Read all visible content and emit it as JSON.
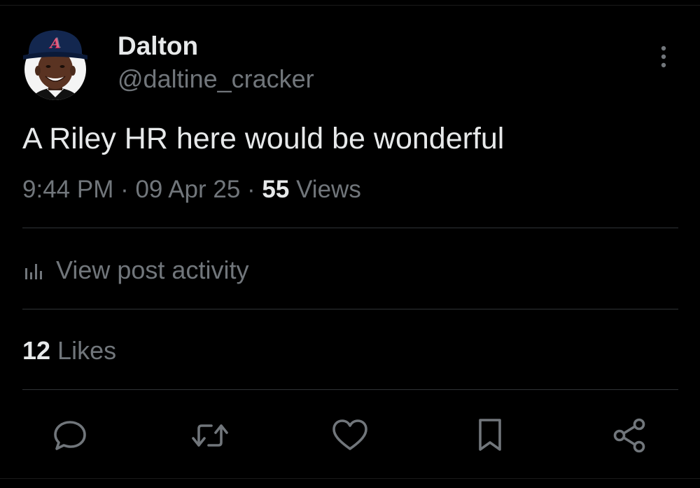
{
  "user": {
    "display_name": "Dalton",
    "handle": "@daltine_cracker",
    "avatar_icon": "avatar-photo"
  },
  "post": {
    "text": "A Riley HR here would be wonderful",
    "time": "9:44 PM",
    "date": "09 Apr 25",
    "separator": " · ",
    "views_count": "55",
    "views_label": " Views"
  },
  "activity": {
    "label": "View post activity",
    "icon": "analytics-icon"
  },
  "likes": {
    "count": "12",
    "label": " Likes"
  },
  "actions": {
    "reply_icon": "reply-icon",
    "repost_icon": "repost-icon",
    "like_icon": "heart-icon",
    "bookmark_icon": "bookmark-icon",
    "share_icon": "share-icon"
  },
  "colors": {
    "background": "#000000",
    "primary_text": "#e7e9ea",
    "secondary_text": "#71767b",
    "divider": "#2f3336"
  }
}
